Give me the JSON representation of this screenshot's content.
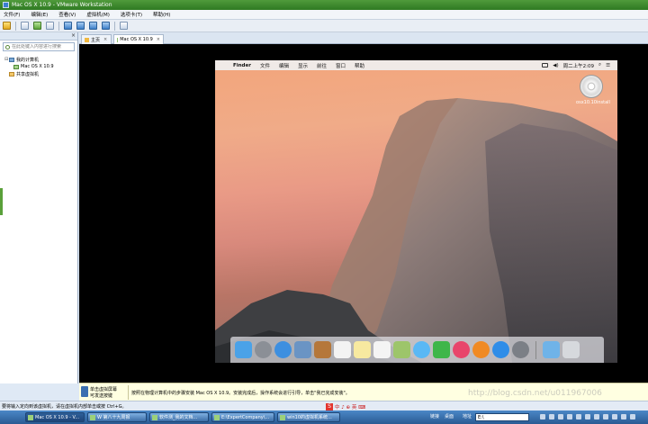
{
  "window": {
    "title": "Mac OS X 10.9 - VMware Workstation"
  },
  "menu": [
    "文件(F)",
    "编辑(E)",
    "查看(V)",
    "虚拟机(M)",
    "选项卡(T)",
    "帮助(H)"
  ],
  "sidebar": {
    "search_placeholder": "在此处键入内容进行搜索",
    "tree": {
      "root": "我的计算机",
      "child": "Mac OS X 10.9",
      "shared": "共享虚拟机"
    }
  },
  "tabs": [
    {
      "label": "主页"
    },
    {
      "label": "Mac OS X 10.9"
    }
  ],
  "mac": {
    "menubar": [
      "Finder",
      "文件",
      "编辑",
      "显示",
      "前往",
      "窗口",
      "帮助"
    ],
    "clock": "周二上午2:09",
    "disk_label": "osx10.10install"
  },
  "dock_icons": [
    {
      "name": "finder-icon",
      "color": "#4aa2e8"
    },
    {
      "name": "launchpad-icon",
      "color": "#8b8f96"
    },
    {
      "name": "safari-icon",
      "color": "#3d8fe0"
    },
    {
      "name": "mail-icon",
      "color": "#6a94c4"
    },
    {
      "name": "contacts-icon",
      "color": "#b5773a"
    },
    {
      "name": "calendar-icon",
      "color": "#f3f3f3"
    },
    {
      "name": "notes-icon",
      "color": "#f7e9a0"
    },
    {
      "name": "reminders-icon",
      "color": "#f4f4f4"
    },
    {
      "name": "photos-icon",
      "color": "#9dc56a"
    },
    {
      "name": "messages-icon",
      "color": "#5ab8f5"
    },
    {
      "name": "facetime-icon",
      "color": "#3fb64a"
    },
    {
      "name": "itunes-icon",
      "color": "#e8456b"
    },
    {
      "name": "ibooks-icon",
      "color": "#f08a24"
    },
    {
      "name": "app-store-icon",
      "color": "#2f8de8"
    },
    {
      "name": "system-preferences-icon",
      "color": "#7b7f86"
    },
    {
      "name": "downloads-icon",
      "color": "#6fb3e8"
    },
    {
      "name": "trash-icon",
      "color": "#d6d9dd"
    }
  ],
  "hint": {
    "line1": "单击虚拟屏幕",
    "line2": "可发送按键",
    "message": "按照在物理计算机中的步骤安装 Mac OS X 10.9。安装完成后，操作系统会进行引导，单击\"我已完成安装\"。"
  },
  "status": {
    "text": "要将输入定向到该虚拟机，请在虚拟机内部单击或按 Ctrl+G。",
    "ime": "中 ♪ ⊕ 英 ⌨"
  },
  "watermark": "http://blog.csdn.net/u011967006",
  "taskbar": {
    "buttons": [
      "Mac OS X 10.9 - V...",
      "W 第八十九周报",
      "软件测_我的文档...",
      "E:\\ExpertCompany\\...",
      "win10的虚拟机系统..."
    ],
    "links": "链接",
    "desktop": "桌面",
    "address_label": "地址",
    "address_value": "E:\\"
  }
}
